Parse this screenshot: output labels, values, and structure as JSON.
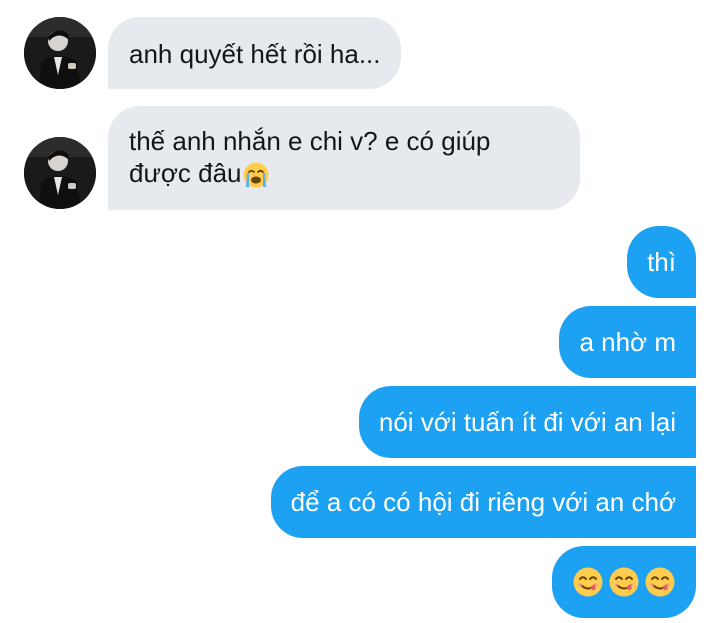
{
  "conversation": {
    "received": [
      {
        "text": "anh quyết hết rồi ha..."
      },
      {
        "line1": "thế anh nhắn e chi v? e có giúp",
        "line2": "được đâu",
        "emoji": "loudly-crying-face"
      }
    ],
    "sent": [
      {
        "text": "thì"
      },
      {
        "text": "a nhờ m"
      },
      {
        "text": "nói với tuấn ít đi với an lại"
      },
      {
        "text": "để a có có hội đi riêng với an chớ"
      },
      {
        "emojis": [
          "face-savoring-food",
          "face-savoring-food",
          "face-savoring-food"
        ]
      }
    ]
  },
  "colors": {
    "received_bubble": "#e6e9ed",
    "sent_bubble": "#1da1f2",
    "received_text": "#14171a",
    "sent_text": "#ffffff"
  }
}
